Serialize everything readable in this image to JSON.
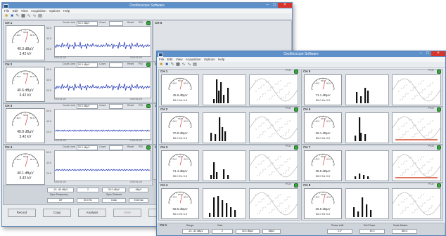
{
  "back_window": {
    "title": "Oscilloscope Software",
    "menu": [
      "File",
      "Edit",
      "View",
      "Acquisition",
      "Options",
      "Help"
    ],
    "channels": [
      {
        "label": "CH 1",
        "level": "40.3 dBµV",
        "voltage": "3.42 kV",
        "scale": [
          "60.0",
          "40.0",
          "20.0"
        ],
        "time_start": "0:00:01:28",
        "time_end": "0:00:01:28"
      },
      {
        "label": "CH 2",
        "level": "40.6 dBµV",
        "voltage": "3.42 kV",
        "scale": [
          "60.0",
          "40.0",
          "20.0"
        ],
        "time_start": "0:00:01:28",
        "time_end": "0:00:01:28"
      },
      {
        "label": "CH 3",
        "level": "48.8 dBµV",
        "voltage": "3.42 kV",
        "scale": [
          "60.0",
          "40.0",
          "20.0"
        ],
        "time_start": "0:00:01:28",
        "time_end": "0:00:01:28"
      },
      {
        "label": "CH 4",
        "level": "40.1 dBµV",
        "voltage": "3.42 kV",
        "scale": [
          "60.0",
          "40.0",
          "20.0"
        ],
        "time_start": "0:00:01:28",
        "time_end": "0:00:01:28"
      }
    ],
    "gauge_ticks": [
      "40.0",
      "50.0",
      "60.0"
    ],
    "side_channels": [
      "CH 5",
      "CH 6",
      "CH 7",
      "CH 8"
    ],
    "panel_controls": {
      "count_label": "Count Limit",
      "count_value": "50.0 dBµV",
      "hold_label": "Count",
      "reset_label": "Reset",
      "pdi_label": "PDI"
    },
    "status": {
      "channel_label": "CH 1",
      "headers": [
        "Range",
        "Gain",
        "LLD",
        "",
        "Timing",
        "",
        "Mode"
      ],
      "row1": [
        "-10...60 dBµV",
        "2",
        "30.0 dBµV",
        "dBµV",
        "",
        "",
        ""
      ],
      "row2_labels": [
        "Sync Frequency",
        "",
        "Sync Channel",
        ""
      ],
      "row2": [
        "Off",
        "50.0 Hz",
        "Data",
        "External"
      ]
    },
    "buttons": [
      "Record",
      "Copy",
      "Analysis",
      "Start",
      "Stop",
      "Close"
    ]
  },
  "front_window": {
    "title": "Oscilloscope Software",
    "menu": [
      "File",
      "Edit",
      "View",
      "Acquisition",
      "Options",
      "Help"
    ],
    "channels": [
      {
        "label": "CH 1",
        "level": "45.6 dBµV",
        "voltage": "50.0 Hz 0.0",
        "pdi": "PCO"
      },
      {
        "label": "CH 5",
        "level": "71.1 dBµV",
        "voltage": "50.0 Hz 0.0",
        "pdi": "PCO"
      },
      {
        "label": "CH 2",
        "level": "70.8 dBµV",
        "voltage": "50.0 Hz 0.0",
        "pdi": "PCO"
      },
      {
        "label": "CH 6",
        "level": "36.1 dBµV",
        "voltage": "50.0 Hz 0.0",
        "pdi": "PCO"
      },
      {
        "label": "CH 3",
        "level": "71.4 dBµV",
        "voltage": "50.0 Hz 0.0",
        "pdi": "PCO"
      },
      {
        "label": "CH 7",
        "level": "38.5 dBµV",
        "voltage": "50.0 Hz 0.0",
        "pdi": "PCO"
      },
      {
        "label": "CH 4",
        "level": "68.5 dBµV",
        "voltage": "50.0 Hz 0.0",
        "pdi": "PCO"
      },
      {
        "label": "CH 8",
        "level": "36.5 dBµV",
        "voltage": "50.0 Hz 0.0",
        "pdi": "PCO"
      }
    ],
    "gauge_ticks": [
      "40.0",
      "50.0",
      "60.0"
    ],
    "status": {
      "channel_label": "CH 1",
      "headers": [
        "Range",
        "Gain",
        "",
        "",
        "Phase shift",
        "Ref Phase",
        "Scale Marker"
      ],
      "row1": [
        "-10...60 dBµV",
        "2",
        "30.0 dBµV",
        "dBµV",
        "0.0°",
        "50.0",
        "360.0"
      ]
    }
  },
  "colors": {
    "titlebar": "#5d8fc9",
    "close": "#d9342c",
    "led": "#3aa640",
    "window": "#e9ecef"
  }
}
